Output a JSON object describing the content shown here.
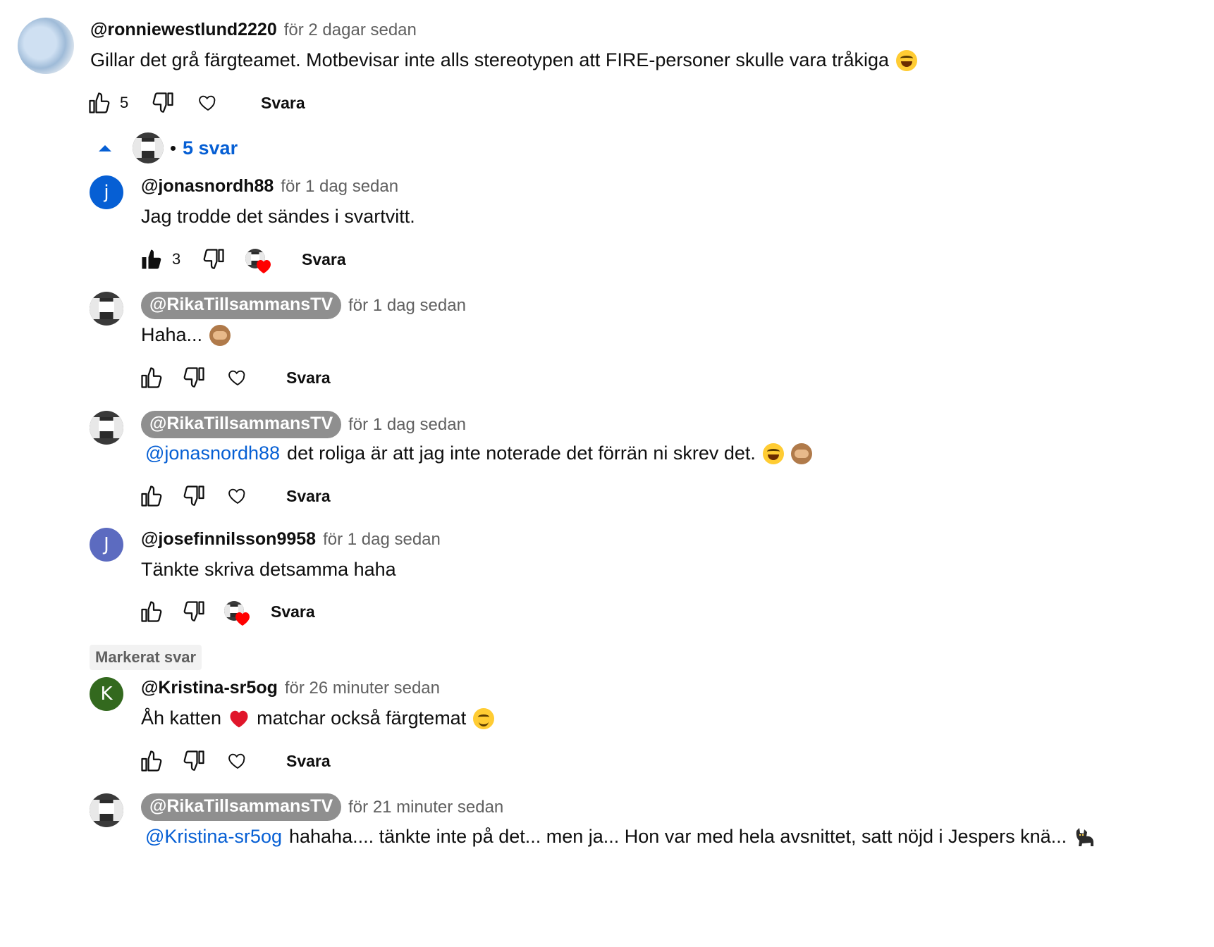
{
  "top_comment": {
    "author": "@ronniewestlund2220",
    "time": "för 2 dagar sedan",
    "text": "Gillar det grå färgteamet. Motbevisar inte alls stereotypen att FIRE-personer skulle vara tråkiga",
    "likes": "5",
    "reply_label": "Svara"
  },
  "replies_toggle": {
    "label": "5 svar"
  },
  "replies": [
    {
      "author": "@jonasnordh88",
      "avatar_letter": "j",
      "avatar_color": "#065fd4",
      "time": "för 1 dag sedan",
      "text": "Jag trodde det sändes i svartvitt.",
      "likes": "3",
      "reply_label": "Svara"
    },
    {
      "author": "@RikaTillsammansTV",
      "time": "för 1 dag sedan",
      "text": "Haha...",
      "reply_label": "Svara"
    },
    {
      "author": "@RikaTillsammansTV",
      "time": "för 1 dag sedan",
      "mention": "@jonasnordh88",
      "text": "det roliga är att jag inte noterade det förrän ni skrev det.",
      "reply_label": "Svara"
    },
    {
      "author": "@josefinnilsson9958",
      "avatar_letter": "J",
      "avatar_color": "#5c6bc0",
      "time": "för 1 dag sedan",
      "text": "Tänkte skriva detsamma haha",
      "reply_label": "Svara"
    }
  ],
  "highlighted": {
    "badge": "Markerat svar",
    "author": "@Kristina-sr5og",
    "avatar_letter": "K",
    "avatar_color": "#33691e",
    "time": "för 26 minuter sedan",
    "text_a": "Åh katten",
    "text_b": "matchar också färgtemat",
    "reply_label": "Svara"
  },
  "last_reply": {
    "author": "@RikaTillsammansTV",
    "time": "för 21 minuter sedan",
    "mention": "@Kristina-sr5og",
    "text": "hahaha.... tänkte inte på det... men ja... Hon var med hela avsnittet, satt nöjd i Jespers knä..."
  }
}
